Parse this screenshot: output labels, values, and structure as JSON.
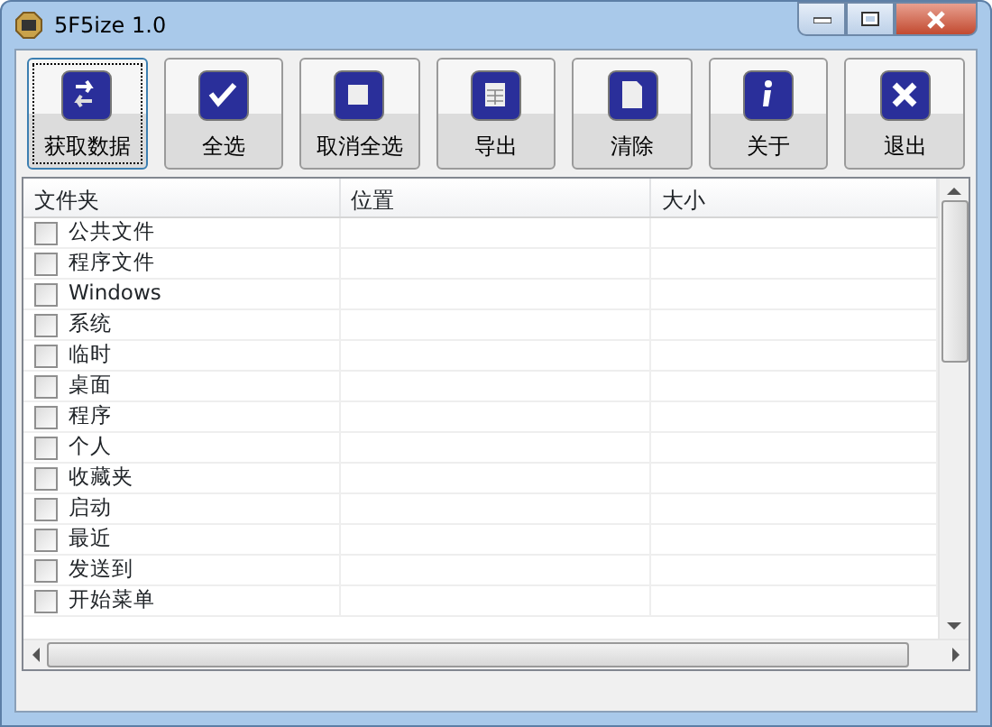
{
  "window": {
    "title": "5F5ize 1.0"
  },
  "toolbar": [
    {
      "label": "获取数据",
      "kind": "arrows",
      "focused": true
    },
    {
      "label": "全选",
      "kind": "check",
      "focused": false
    },
    {
      "label": "取消全选",
      "kind": "square",
      "focused": false
    },
    {
      "label": "导出",
      "kind": "table",
      "focused": false
    },
    {
      "label": "清除",
      "kind": "document",
      "focused": false
    },
    {
      "label": "关于",
      "kind": "info",
      "focused": false
    },
    {
      "label": "退出",
      "kind": "close",
      "focused": false
    }
  ],
  "table": {
    "columns": [
      "文件夹",
      "位置",
      "大小"
    ],
    "rows": [
      {
        "name": "公共文件",
        "checked": false
      },
      {
        "name": "程序文件",
        "checked": false
      },
      {
        "name": "Windows",
        "checked": false
      },
      {
        "name": "系统",
        "checked": false
      },
      {
        "name": "临时",
        "checked": false
      },
      {
        "name": "桌面",
        "checked": false
      },
      {
        "name": "程序",
        "checked": false
      },
      {
        "name": "个人",
        "checked": false
      },
      {
        "name": "收藏夹",
        "checked": false
      },
      {
        "name": "启动",
        "checked": false
      },
      {
        "name": "最近",
        "checked": false
      },
      {
        "name": "发送到",
        "checked": false
      },
      {
        "name": "开始菜单",
        "checked": false
      }
    ]
  }
}
